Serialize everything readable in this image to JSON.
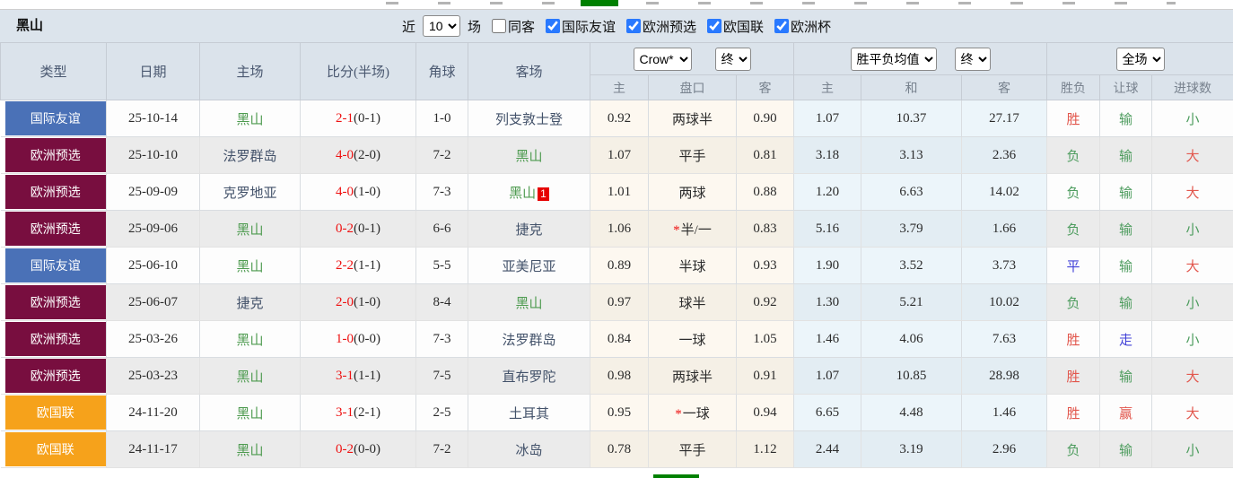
{
  "page": {
    "team_title": "黑山",
    "filter": {
      "recent_label": "近",
      "recent_value": "10",
      "matches_label": "场",
      "same_venue_label": "同客",
      "competitions": [
        {
          "label": "国际友谊",
          "checked_attr": "checked"
        },
        {
          "label": "欧洲预选",
          "checked_attr": "checked"
        },
        {
          "label": "欧国联",
          "checked_attr": "checked"
        },
        {
          "label": "欧洲杯",
          "checked_attr": "checked"
        }
      ]
    },
    "colors": {
      "score_red": "#ee1111",
      "team": "#4e9b50",
      "opponent": "#43526a",
      "red": "#e2574d",
      "green": "#4d9c5e",
      "blue": "#4343d8",
      "accent_green_box": "#008000"
    },
    "table": {
      "headers": [
        "类型",
        "日期",
        "主场",
        "比分(半场)",
        "角球",
        "客场"
      ],
      "selects": {
        "odds_source": "Crow*",
        "odds_time": "终",
        "mean_label": "胜平负均值",
        "mean_time": "终",
        "scope": "全场"
      },
      "sub_headers": [
        "主",
        "盘口",
        "客",
        "主",
        "和",
        "客",
        "胜负",
        "让球",
        "进球数"
      ],
      "rows": [
        {
          "type": "国际友谊",
          "type_color": "#4a71b7",
          "date": "25-10-14",
          "home": "黑山",
          "home_is_focus": true,
          "score_ft": "2-1",
          "score_ht": "(0-1)",
          "corner": "1-0",
          "away": "列支敦士登",
          "away_is_focus": false,
          "away_card": "",
          "odds_home": "0.92",
          "handicap": "两球半",
          "handicap_star": false,
          "odds_away": "0.90",
          "mean_home": "1.07",
          "mean_draw": "10.37",
          "mean_away": "27.17",
          "result": {
            "text": "胜",
            "color": "red"
          },
          "handicap_result": {
            "text": "输",
            "color": "green"
          },
          "goals": {
            "text": "小",
            "color": "green"
          }
        },
        {
          "type": "欧洲预选",
          "type_color": "#780e3f",
          "date": "25-10-10",
          "home": "法罗群岛",
          "home_is_focus": false,
          "score_ft": "4-0",
          "score_ht": "(2-0)",
          "corner": "7-2",
          "away": "黑山",
          "away_is_focus": true,
          "away_card": "",
          "odds_home": "1.07",
          "handicap": "平手",
          "handicap_star": false,
          "odds_away": "0.81",
          "mean_home": "3.18",
          "mean_draw": "3.13",
          "mean_away": "2.36",
          "result": {
            "text": "负",
            "color": "green"
          },
          "handicap_result": {
            "text": "输",
            "color": "green"
          },
          "goals": {
            "text": "大",
            "color": "red"
          }
        },
        {
          "type": "欧洲预选",
          "type_color": "#780e3f",
          "date": "25-09-09",
          "home": "克罗地亚",
          "home_is_focus": false,
          "score_ft": "4-0",
          "score_ht": "(1-0)",
          "corner": "7-3",
          "away": "黑山",
          "away_is_focus": true,
          "away_card": "1",
          "odds_home": "1.01",
          "handicap": "两球",
          "handicap_star": false,
          "odds_away": "0.88",
          "mean_home": "1.20",
          "mean_draw": "6.63",
          "mean_away": "14.02",
          "result": {
            "text": "负",
            "color": "green"
          },
          "handicap_result": {
            "text": "输",
            "color": "green"
          },
          "goals": {
            "text": "大",
            "color": "red"
          }
        },
        {
          "type": "欧洲预选",
          "type_color": "#780e3f",
          "date": "25-09-06",
          "home": "黑山",
          "home_is_focus": true,
          "score_ft": "0-2",
          "score_ht": "(0-1)",
          "corner": "6-6",
          "away": "捷克",
          "away_is_focus": false,
          "away_card": "",
          "odds_home": "1.06",
          "handicap": "半/一",
          "handicap_star": true,
          "odds_away": "0.83",
          "mean_home": "5.16",
          "mean_draw": "3.79",
          "mean_away": "1.66",
          "result": {
            "text": "负",
            "color": "green"
          },
          "handicap_result": {
            "text": "输",
            "color": "green"
          },
          "goals": {
            "text": "小",
            "color": "green"
          }
        },
        {
          "type": "国际友谊",
          "type_color": "#4a71b7",
          "date": "25-06-10",
          "home": "黑山",
          "home_is_focus": true,
          "score_ft": "2-2",
          "score_ht": "(1-1)",
          "corner": "5-5",
          "away": "亚美尼亚",
          "away_is_focus": false,
          "away_card": "",
          "odds_home": "0.89",
          "handicap": "半球",
          "handicap_star": false,
          "odds_away": "0.93",
          "mean_home": "1.90",
          "mean_draw": "3.52",
          "mean_away": "3.73",
          "result": {
            "text": "平",
            "color": "blue"
          },
          "handicap_result": {
            "text": "输",
            "color": "green"
          },
          "goals": {
            "text": "大",
            "color": "red"
          }
        },
        {
          "type": "欧洲预选",
          "type_color": "#780e3f",
          "date": "25-06-07",
          "home": "捷克",
          "home_is_focus": false,
          "score_ft": "2-0",
          "score_ht": "(1-0)",
          "corner": "8-4",
          "away": "黑山",
          "away_is_focus": true,
          "away_card": "",
          "odds_home": "0.97",
          "handicap": "球半",
          "handicap_star": false,
          "odds_away": "0.92",
          "mean_home": "1.30",
          "mean_draw": "5.21",
          "mean_away": "10.02",
          "result": {
            "text": "负",
            "color": "green"
          },
          "handicap_result": {
            "text": "输",
            "color": "green"
          },
          "goals": {
            "text": "小",
            "color": "green"
          }
        },
        {
          "type": "欧洲预选",
          "type_color": "#780e3f",
          "date": "25-03-26",
          "home": "黑山",
          "home_is_focus": true,
          "score_ft": "1-0",
          "score_ht": "(0-0)",
          "corner": "7-3",
          "away": "法罗群岛",
          "away_is_focus": false,
          "away_card": "",
          "odds_home": "0.84",
          "handicap": "一球",
          "handicap_star": false,
          "odds_away": "1.05",
          "mean_home": "1.46",
          "mean_draw": "4.06",
          "mean_away": "7.63",
          "result": {
            "text": "胜",
            "color": "red"
          },
          "handicap_result": {
            "text": "走",
            "color": "blue"
          },
          "goals": {
            "text": "小",
            "color": "green"
          }
        },
        {
          "type": "欧洲预选",
          "type_color": "#780e3f",
          "date": "25-03-23",
          "home": "黑山",
          "home_is_focus": true,
          "score_ft": "3-1",
          "score_ht": "(1-1)",
          "corner": "7-5",
          "away": "直布罗陀",
          "away_is_focus": false,
          "away_card": "",
          "odds_home": "0.98",
          "handicap": "两球半",
          "handicap_star": false,
          "odds_away": "0.91",
          "mean_home": "1.07",
          "mean_draw": "10.85",
          "mean_away": "28.98",
          "result": {
            "text": "胜",
            "color": "red"
          },
          "handicap_result": {
            "text": "输",
            "color": "green"
          },
          "goals": {
            "text": "大",
            "color": "red"
          }
        },
        {
          "type": "欧国联",
          "type_color": "#f6a21b",
          "date": "24-11-20",
          "home": "黑山",
          "home_is_focus": true,
          "score_ft": "3-1",
          "score_ht": "(2-1)",
          "corner": "2-5",
          "away": "土耳其",
          "away_is_focus": false,
          "away_card": "",
          "odds_home": "0.95",
          "handicap": "一球",
          "handicap_star": true,
          "odds_away": "0.94",
          "mean_home": "6.65",
          "mean_draw": "4.48",
          "mean_away": "1.46",
          "result": {
            "text": "胜",
            "color": "red"
          },
          "handicap_result": {
            "text": "赢",
            "color": "red"
          },
          "goals": {
            "text": "大",
            "color": "red"
          }
        },
        {
          "type": "欧国联",
          "type_color": "#f6a21b",
          "date": "24-11-17",
          "home": "黑山",
          "home_is_focus": true,
          "score_ft": "0-2",
          "score_ht": "(0-0)",
          "corner": "7-2",
          "away": "冰岛",
          "away_is_focus": false,
          "away_card": "",
          "odds_home": "0.78",
          "handicap": "平手",
          "handicap_star": false,
          "odds_away": "1.12",
          "mean_home": "2.44",
          "mean_draw": "3.19",
          "mean_away": "2.96",
          "result": {
            "text": "负",
            "color": "green"
          },
          "handicap_result": {
            "text": "输",
            "color": "green"
          },
          "goals": {
            "text": "小",
            "color": "green"
          }
        }
      ]
    }
  }
}
